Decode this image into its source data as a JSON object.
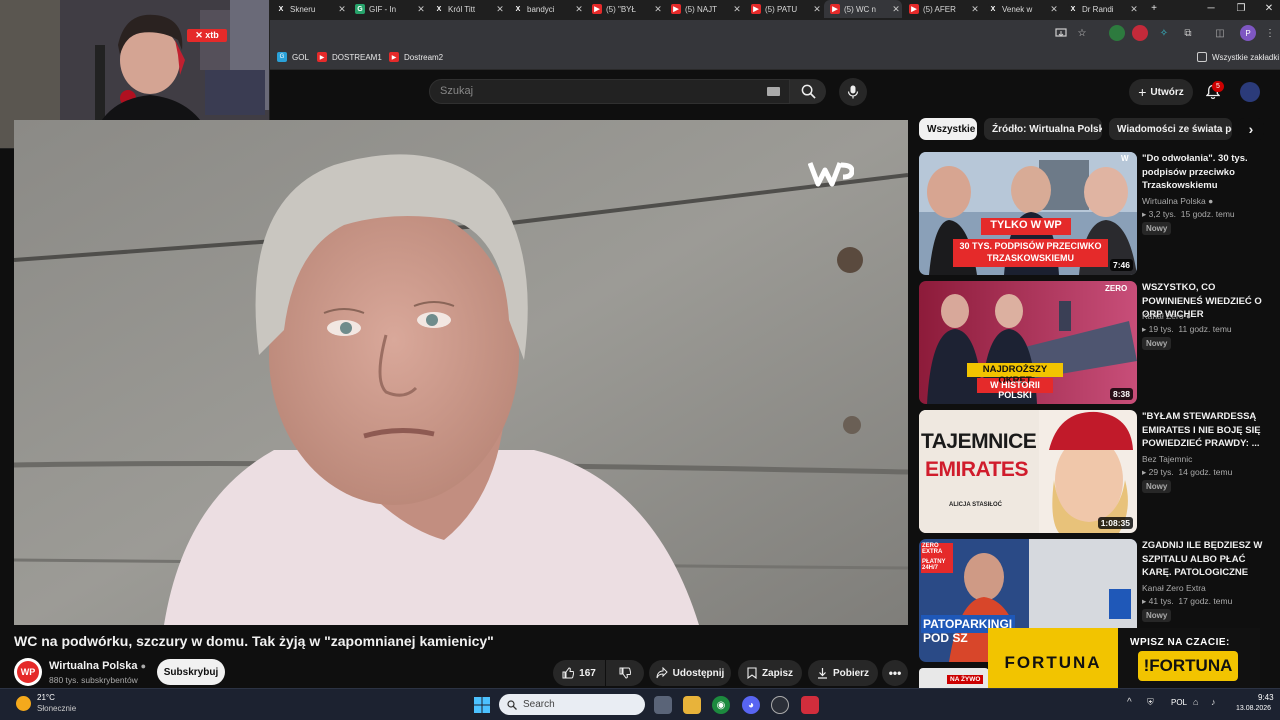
{
  "browser": {
    "tabs": [
      {
        "title": "Skneru",
        "icon": "x-logo-icon",
        "active": false
      },
      {
        "title": "GIF - In",
        "icon": "gif-icon",
        "active": false
      },
      {
        "title": "Król Titt",
        "icon": "x-logo-icon",
        "active": false
      },
      {
        "title": "bandyci",
        "icon": "x-logo-icon",
        "active": false
      },
      {
        "title": "(5) \"BYŁ",
        "icon": "youtube-icon",
        "active": false
      },
      {
        "title": "(5) NAJT",
        "icon": "youtube-icon",
        "active": false
      },
      {
        "title": "(5) PATU",
        "icon": "youtube-icon",
        "active": false
      },
      {
        "title": "(5) WC n",
        "icon": "youtube-icon",
        "active": true
      },
      {
        "title": "(5) AFER",
        "icon": "youtube-icon",
        "active": false
      },
      {
        "title": "Venek w",
        "icon": "x-logo-icon",
        "active": false
      },
      {
        "title": "Dr Randi",
        "icon": "x-logo-icon",
        "active": false
      }
    ],
    "new_tab": "+",
    "bookmarks": [
      {
        "label": "GOL",
        "color": "#2aa1d8"
      },
      {
        "label": "DOSTREAM1",
        "color": "#e52a2a"
      },
      {
        "label": "Dostream2",
        "color": "#e52a2a"
      }
    ],
    "all_bookmarks": "Wszystkie zakładki",
    "profile_initial": "P"
  },
  "webcam": {
    "badge": "xtb"
  },
  "youtube": {
    "search_placeholder": "Szukaj",
    "create_label": "Utwórz",
    "notification_count": "5",
    "video": {
      "title": "WC na podwórku, szczury w domu. Tak żyją w \"zapomnianej kamienicy\"",
      "channel": "Wirtualna Polska",
      "channel_initials": "WP",
      "subscribers": "880 tys. subskrybentów",
      "subscribe_label": "Subskrybuj",
      "likes": "167",
      "share_label": "Udostępnij",
      "save_label": "Zapisz",
      "download_label": "Pobierz"
    },
    "chips": [
      "Wszystkie",
      "Źródło: Wirtualna Polska",
      "Wiadomości ze świata polityki"
    ],
    "recommendations": [
      {
        "title": "\"Do odwołania\". 30 tys. podpisów przeciwko Trzaskowskiemu",
        "channel": "Wirtualna Polska",
        "verified": true,
        "views": "3,2 tys.",
        "age": "15 godz. temu",
        "badge": "Nowy",
        "duration": "7:46",
        "thumb_text_top": "TYLKO W WP",
        "thumb_text_bottom": "30 TYS. PODPISÓW PRZECIWKO TRZASKOWSKIEMU"
      },
      {
        "title": "WSZYSTKO, CO POWINIENEŚ WIEDZIEĆ O ORP WICHER",
        "channel": "Kanał Zero",
        "verified": true,
        "views": "19 tys.",
        "age": "11 godz. temu",
        "badge": "Nowy",
        "duration": "8:38",
        "thumb_text_top": "NAJDROŻSZY OKRĘT",
        "thumb_text_bottom": "W HISTORII POLSKI",
        "thumb_corner": "ZERO"
      },
      {
        "title": "\"BYŁAM STEWARDESSĄ EMIRATES I NIE BOJĘ SIĘ POWIEDZIEĆ PRAWDY: ...",
        "channel": "Bez Tajemnic",
        "verified": false,
        "views": "29 tys.",
        "age": "14 godz. temu",
        "badge": "Nowy",
        "duration": "1:08:35",
        "thumb_text_top": "TAJEMNICE",
        "thumb_text_bottom": "EMIRATES",
        "thumb_small": "ALICJA STASIŁOĆ"
      },
      {
        "title": "ZGADNIJ ILE BĘDZIESZ W SZPITALU ALBO PŁAĆ KARĘ. PATOLOGICZNE PARKINGI",
        "channel": "Kanał Zero Extra",
        "verified": false,
        "views": "41 tys.",
        "age": "17 godz. temu",
        "badge": "Nowy",
        "duration": "",
        "thumb_text_top": "PŁATNY 24H/7",
        "thumb_text_bottom": "PATOPARKINGI POD SZ",
        "thumb_corner": "ZERO EXTRA"
      }
    ],
    "live_label": "NA ŻYWO"
  },
  "ad": {
    "logo": "FORTUNA",
    "caption": "WPISZ NA CZACIE:",
    "command": "!FORTUNA"
  },
  "taskbar": {
    "weather_temp": "21°C",
    "weather_desc": "Słonecznie",
    "search_placeholder": "Search",
    "language": "POL",
    "time": "9:43",
    "date": "13.08.2026"
  }
}
